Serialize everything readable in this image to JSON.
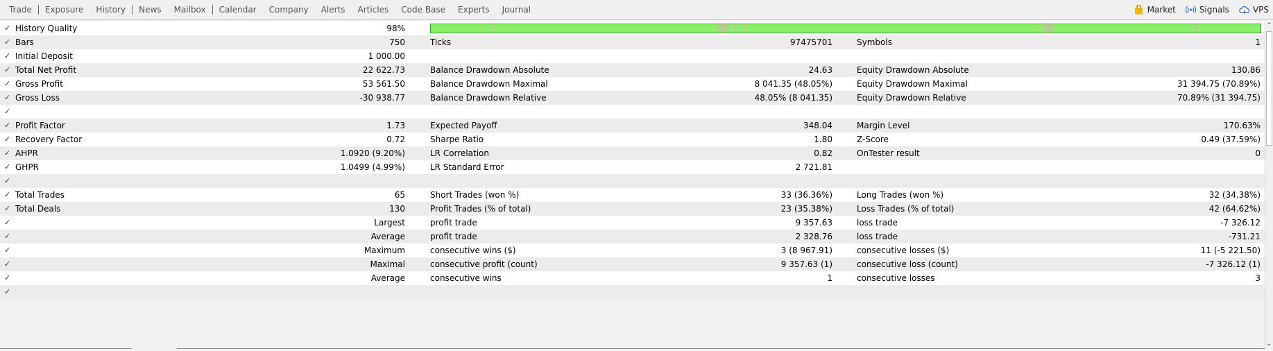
{
  "toolbar": {
    "tabs": [
      "Trade",
      "Exposure",
      "History",
      "News",
      "Mailbox",
      "Calendar",
      "Company",
      "Alerts",
      "Articles",
      "Code Base",
      "Experts",
      "Journal"
    ],
    "right": {
      "market": "Market",
      "signals": "Signals",
      "vps": "VPS"
    }
  },
  "colors": {
    "quality_bar": "#8cf06c",
    "quality_gap": "#b3d08a",
    "row_alt": "#ececec"
  },
  "report": {
    "history_quality": {
      "label": "History Quality",
      "value": "98%",
      "fill_fraction": 0.98
    },
    "bars": {
      "label": "Bars",
      "value": "750"
    },
    "ticks": {
      "label": "Ticks",
      "value": "97475701"
    },
    "symbols": {
      "label": "Symbols",
      "value": "1"
    },
    "initial_deposit": {
      "label": "Initial Deposit",
      "value": "1 000.00"
    },
    "total_net_profit": {
      "label": "Total Net Profit",
      "value": "22 622.73"
    },
    "balance_dd_abs": {
      "label": "Balance Drawdown Absolute",
      "value": "24.63"
    },
    "equity_dd_abs": {
      "label": "Equity Drawdown Absolute",
      "value": "130.86"
    },
    "gross_profit": {
      "label": "Gross Profit",
      "value": "53 561.50"
    },
    "balance_dd_max": {
      "label": "Balance Drawdown Maximal",
      "value": "8 041.35 (48.05%)"
    },
    "equity_dd_max": {
      "label": "Equity Drawdown Maximal",
      "value": "31 394.75 (70.89%)"
    },
    "gross_loss": {
      "label": "Gross Loss",
      "value": "-30 938.77"
    },
    "balance_dd_rel": {
      "label": "Balance Drawdown Relative",
      "value": "48.05% (8 041.35)"
    },
    "equity_dd_rel": {
      "label": "Equity Drawdown Relative",
      "value": "70.89% (31 394.75)"
    },
    "profit_factor": {
      "label": "Profit Factor",
      "value": "1.73"
    },
    "expected_payoff": {
      "label": "Expected Payoff",
      "value": "348.04"
    },
    "margin_level": {
      "label": "Margin Level",
      "value": "170.63%"
    },
    "recovery_factor": {
      "label": "Recovery Factor",
      "value": "0.72"
    },
    "sharpe_ratio": {
      "label": "Sharpe Ratio",
      "value": "1.80"
    },
    "z_score": {
      "label": "Z-Score",
      "value": "0.49 (37.59%)"
    },
    "ahpr": {
      "label": "AHPR",
      "value": "1.0920 (9.20%)"
    },
    "lr_correlation": {
      "label": "LR Correlation",
      "value": "0.82"
    },
    "ontester": {
      "label": "OnTester result",
      "value": "0"
    },
    "ghpr": {
      "label": "GHPR",
      "value": "1.0499 (4.99%)"
    },
    "lr_std_error": {
      "label": "LR Standard Error",
      "value": "2 721.81"
    },
    "total_trades": {
      "label": "Total Trades",
      "value": "65"
    },
    "short_trades": {
      "label": "Short Trades (won %)",
      "value": "33 (36.36%)"
    },
    "long_trades": {
      "label": "Long Trades (won %)",
      "value": "32 (34.38%)"
    },
    "total_deals": {
      "label": "Total Deals",
      "value": "130"
    },
    "profit_trades": {
      "label": "Profit Trades (% of total)",
      "value": "23 (35.38%)"
    },
    "loss_trades": {
      "label": "Loss Trades (% of total)",
      "value": "42 (64.62%)"
    },
    "largest": {
      "label": "Largest",
      "c2": "profit trade",
      "v2": "9 357.63",
      "c3": "loss trade",
      "v3": "-7 326.12"
    },
    "average": {
      "label": "Average",
      "c2": "profit trade",
      "v2": "2 328.76",
      "c3": "loss trade",
      "v3": "-731.21"
    },
    "maximum": {
      "label": "Maximum",
      "c2": "consecutive wins ($)",
      "v2": "3 (8 967.91)",
      "c3": "consecutive losses ($)",
      "v3": "11 (-5 221.50)"
    },
    "maximal": {
      "label": "Maximal",
      "c2": "consecutive profit (count)",
      "v2": "9 357.63 (1)",
      "c3": "consecutive loss (count)",
      "v3": "-7 326.12 (1)"
    },
    "average2": {
      "label": "Average",
      "c2": "consecutive wins",
      "v2": "1",
      "c3": "consecutive losses",
      "v3": "3"
    }
  }
}
